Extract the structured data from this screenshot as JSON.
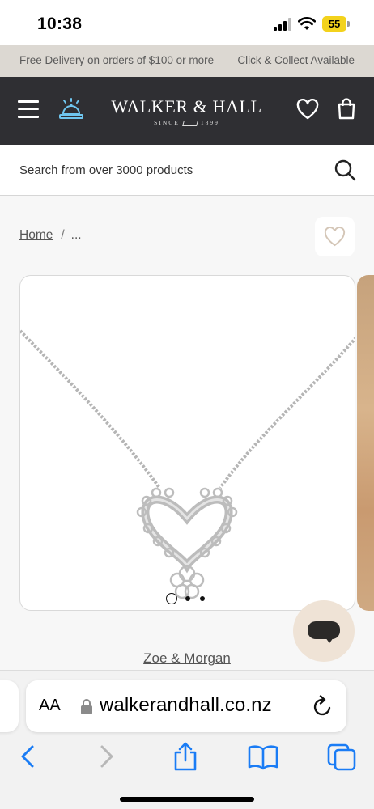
{
  "status": {
    "time": "10:38",
    "battery": "55"
  },
  "promo": {
    "left": "Free Delivery on orders of $100 or more",
    "right": "Click & Collect Available"
  },
  "header": {
    "brand": "WALKER & HALL",
    "since_prefix": "SINCE",
    "since_year": "1899"
  },
  "search": {
    "placeholder": "Search from over 3000 products"
  },
  "breadcrumb": {
    "home": "Home",
    "separator": "/",
    "current": "..."
  },
  "gallery": {
    "slides": 3,
    "active_slide": 1
  },
  "product": {
    "brand_link": "Zoe & Morgan"
  },
  "browser": {
    "aa_label": "AA",
    "url": "walkerandhall.co.nz"
  },
  "icons": [
    "hamburger-icon",
    "bell-icon",
    "heart-icon",
    "bag-icon",
    "search-icon",
    "wishlist-heart-icon",
    "chat-icon",
    "lock-icon",
    "reload-icon",
    "back-icon",
    "forward-icon",
    "share-icon",
    "bookmarks-icon",
    "tabs-icon"
  ],
  "colors": {
    "header_bg": "#2f2f33",
    "promo_bg": "#dcd8d2",
    "accent_blue": "#1a7cf5",
    "bell_blue": "#6fc6ef",
    "chat_bg": "#efe3d6"
  }
}
